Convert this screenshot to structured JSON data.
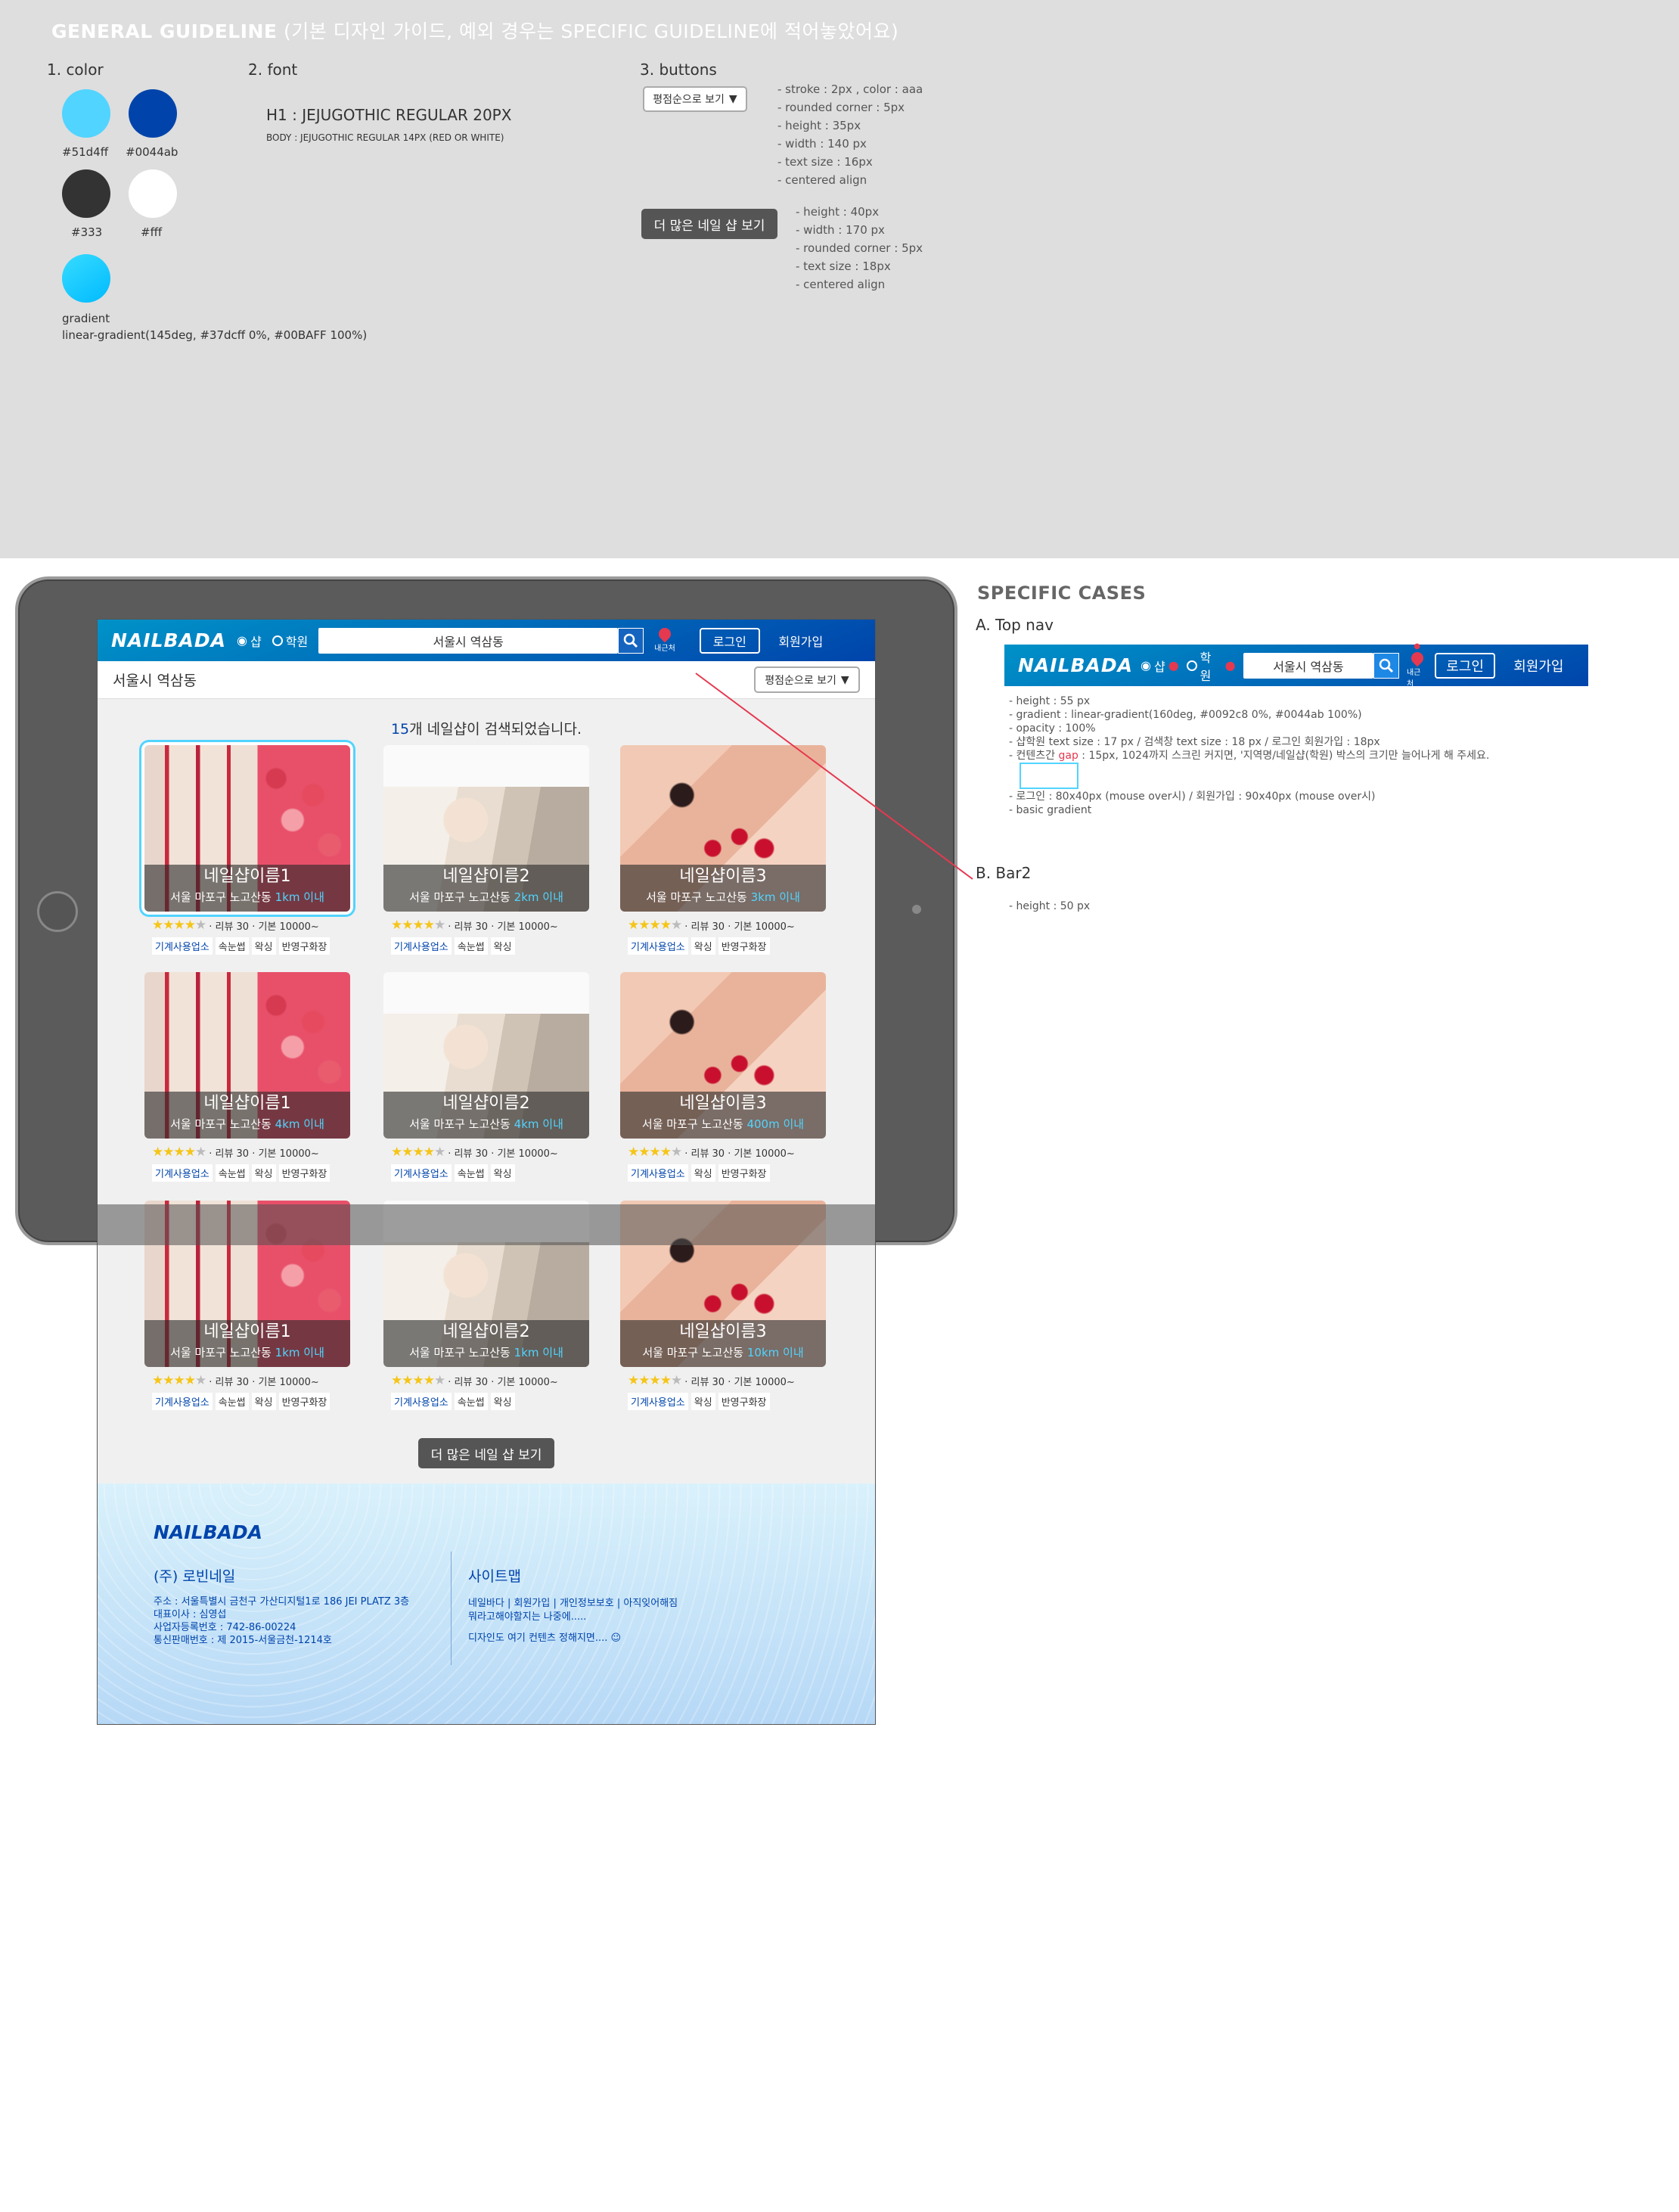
{
  "guide": {
    "title_bold": "GENERAL GUIDELINE",
    "title_rest": " (기본 디자인 가이드, 예외 경우는 SPECIFIC GUIDELINE에 적어놓았어요)",
    "color_label": "1. color",
    "colors": [
      {
        "hex": "#51d4ff",
        "label": "#51d4ff"
      },
      {
        "hex": "#0044ab",
        "label": "#0044ab"
      },
      {
        "hex": "#333333",
        "label": "#333"
      },
      {
        "hex": "#ffffff",
        "label": "#fff"
      }
    ],
    "gradient_label": "gradient",
    "gradient_value": "linear-gradient(145deg, #37dcff 0%, #00BAFF 100%)",
    "font_label": "2. font",
    "font_h1": "H1 : JEJUGOTHIC REGULAR 20PX",
    "font_body": "BODY : JEJUGOTHIC REGULAR 14PX (RED OR WHITE)",
    "buttons_label": "3. buttons",
    "sort_button": "평점순으로 보기",
    "sort_notes": [
      "- stroke : 2px , color : aaa",
      "- rounded corner : 5px",
      "- height : 35px",
      "- width : 140 px",
      "- text size : 16px",
      "- centered align"
    ],
    "more_button": "더 많은 네일 샵 보기",
    "more_notes": [
      "- height : 40px",
      "- width : 170 px",
      "- rounded corner : 5px",
      "- text size : 18px",
      "- centered align"
    ]
  },
  "app": {
    "logo": "NAILBADA",
    "radio_shop": "샵",
    "radio_academy": "학원",
    "search_value": "서울시 역삼동",
    "nearby": "내근처",
    "login": "로그인",
    "signup": "회원가입",
    "location_title": "서울시 역삼동",
    "sort": "평점순으로 보기",
    "count_num": "15",
    "count_text": "개 네일샵이 검색되었습니다.",
    "more": "더 많은 네일 샵 보기",
    "cards": [
      {
        "name": "네일샵이름1",
        "addr": "서울 마포구 노고산동",
        "dist": "1km 이내",
        "reviews": "· 리뷰 30 · 기본 10000~",
        "rating": 4.5,
        "tags": [
          "기계사용업소",
          "속눈썹",
          "왁싱",
          "반영구화장"
        ]
      },
      {
        "name": "네일샵이름2",
        "addr": "서울 마포구 노고산동",
        "dist": "2km 이내",
        "reviews": "· 리뷰 30 · 기본 10000~",
        "rating": 4.5,
        "tags": [
          "기계사용업소",
          "속눈썹",
          "왁싱"
        ]
      },
      {
        "name": "네일샵이름3",
        "addr": "서울 마포구 노고산동",
        "dist": "3km 이내",
        "reviews": "· 리뷰 30 · 기본 10000~",
        "rating": 4.5,
        "tags": [
          "기계사용업소",
          "왁싱",
          "반영구화장"
        ]
      },
      {
        "name": "네일샵이름1",
        "addr": "서울 마포구 노고산동",
        "dist": "4km 이내",
        "reviews": "· 리뷰 30 · 기본 10000~",
        "rating": 4.5,
        "tags": [
          "기계사용업소",
          "속눈썹",
          "왁싱",
          "반영구화장"
        ]
      },
      {
        "name": "네일샵이름2",
        "addr": "서울 마포구 노고산동",
        "dist": "4km 이내",
        "reviews": "· 리뷰 30 · 기본 10000~",
        "rating": 4.5,
        "tags": [
          "기계사용업소",
          "속눈썹",
          "왁싱"
        ]
      },
      {
        "name": "네일샵이름3",
        "addr": "서울 마포구 노고산동",
        "dist": "400m 이내",
        "reviews": "· 리뷰 30 · 기본 10000~",
        "rating": 4.5,
        "tags": [
          "기계사용업소",
          "왁싱",
          "반영구화장"
        ]
      },
      {
        "name": "네일샵이름1",
        "addr": "서울 마포구 노고산동",
        "dist": "1km 이내",
        "reviews": "· 리뷰 30 · 기본 10000~",
        "rating": 4.5,
        "tags": [
          "기계사용업소",
          "속눈썹",
          "왁싱",
          "반영구화장"
        ]
      },
      {
        "name": "네일샵이름2",
        "addr": "서울 마포구 노고산동",
        "dist": "1km 이내",
        "reviews": "· 리뷰 30 · 기본 10000~",
        "rating": 4.5,
        "tags": [
          "기계사용업소",
          "속눈썹",
          "왁싱"
        ]
      },
      {
        "name": "네일샵이름3",
        "addr": "서울 마포구 노고산동",
        "dist": "10km 이내",
        "reviews": "· 리뷰 30 · 기본 10000~",
        "rating": 4.5,
        "tags": [
          "기계사용업소",
          "왁싱",
          "반영구화장"
        ]
      }
    ],
    "footer": {
      "logo": "NAILBADA",
      "company": "(주) 로빈네일",
      "info": [
        "주소 : 서울특별시 금천구 가산디지털1로 186 JEI PLATZ 3층",
        "대표이사 : 심영섭",
        "사업자등록번호 : 742-86-00224",
        "통신판매번호 : 제 2015-서울금천-1214호"
      ],
      "sitemap": "사이트맵",
      "links": [
        "네일바다    |    회원가입    |    개인정보보호    |    아직잊어해짐",
        "뭐라고해야할지는 나중에.....",
        "",
        "디자인도 여기 컨텐츠 정해지면.... ☺"
      ]
    }
  },
  "spec": {
    "title": "SPECIFIC CASES",
    "a_label": "A. Top nav",
    "a_notes": [
      "- height : 55 px",
      "- gradient : linear-gradient(160deg, #0092c8 0%, #0044ab 100%)",
      "- opacity : 100%",
      "- 샵학원 text size : 17 px / 검색창 text size : 18 px / 로그인 회원가입 : 18px"
    ],
    "a_gap_pre": "- 컨텐츠간 ",
    "a_gap_word": "gap",
    "a_gap_post": " : 15px, 1024까지 스크린 커지면, '지역명/네일샵(학원) 박스의 크기만 늘어나게 해 주세요.",
    "a_notes2": [
      "- 로그인 : 80x40px (mouse over시) / 회원가입 : 90x40px (mouse over시)",
      "- basic gradient"
    ],
    "b_label": "B. Bar2",
    "b_note": "- height : 50 px"
  }
}
